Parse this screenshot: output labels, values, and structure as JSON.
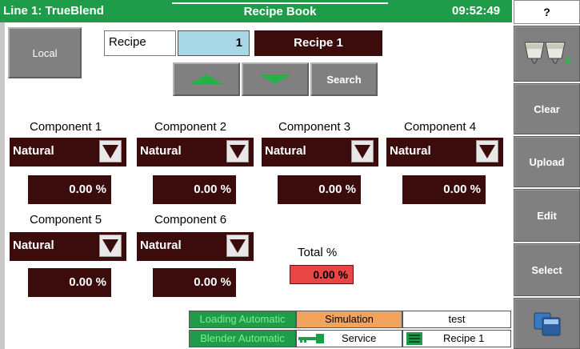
{
  "header": {
    "line_title": "Line 1: TrueBlend",
    "screen_title": "Recipe Book",
    "clock": "09:52:49"
  },
  "help_label": "?",
  "side_buttons": {
    "clear": "Clear",
    "upload": "Upload",
    "edit": "Edit",
    "select": "Select"
  },
  "local_button": "Local",
  "recipe": {
    "label": "Recipe",
    "number": "1",
    "name": "Recipe 1"
  },
  "search_label": "Search",
  "components": [
    {
      "label": "Component 1",
      "material": "Natural",
      "percent": "0.00 %"
    },
    {
      "label": "Component 2",
      "material": "Natural",
      "percent": "0.00 %"
    },
    {
      "label": "Component 3",
      "material": "Natural",
      "percent": "0.00 %"
    },
    {
      "label": "Component 4",
      "material": "Natural",
      "percent": "0.00 %"
    },
    {
      "label": "Component 5",
      "material": "Natural",
      "percent": "0.00 %"
    },
    {
      "label": "Component 6",
      "material": "Natural",
      "percent": "0.00 %"
    }
  ],
  "total": {
    "label": "Total %",
    "value": "0.00 %"
  },
  "status": {
    "loading": "Loading Automatic",
    "simulation": "Simulation",
    "test": "test",
    "blender": "Blender Automatic",
    "service": "Service",
    "recipe": "Recipe 1"
  },
  "colors": {
    "header_green": "#1f9c4a",
    "field_dark": "#3c0c0c",
    "button_gray": "#808080",
    "recipe_number_bg": "#a8d8e8",
    "total_alarm": "#e84545",
    "simulation_orange": "#f2a45e"
  },
  "icons": [
    "hoppers-add-icon",
    "arrow-up-icon",
    "arrow-down-icon",
    "dropdown-arrow-icon",
    "key-icon",
    "recipe-list-icon",
    "screen-switch-icon"
  ]
}
